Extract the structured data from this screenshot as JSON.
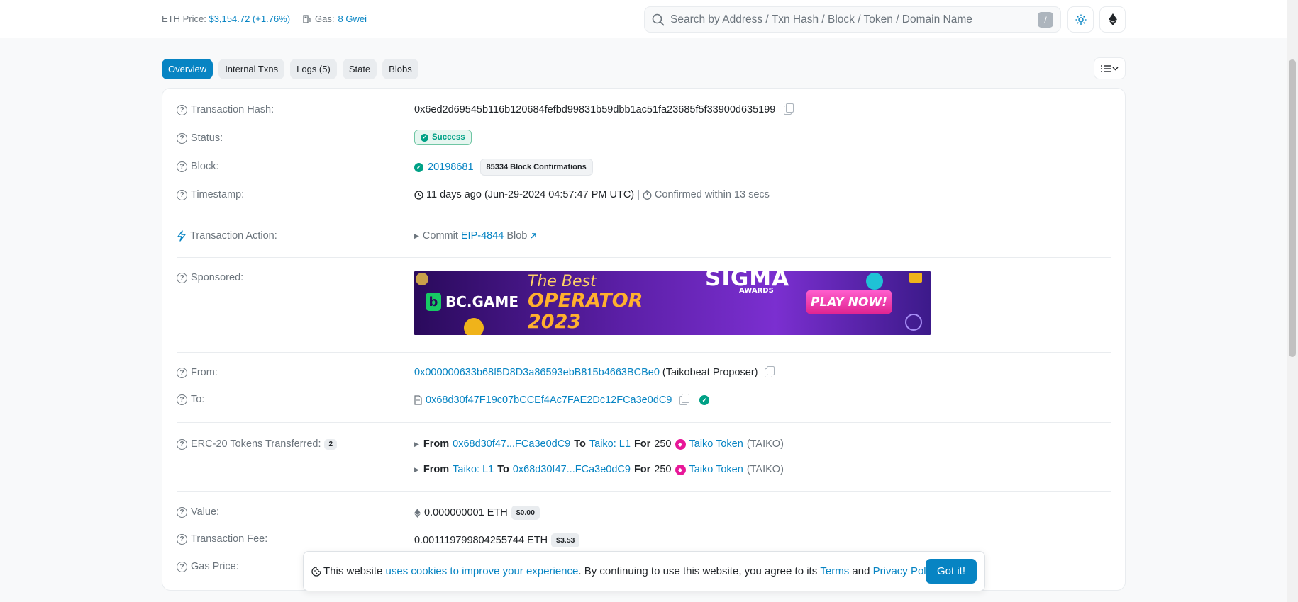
{
  "header": {
    "eth_price_label": "ETH Price:",
    "eth_price_value": "$3,154.72 (+1.76%)",
    "gas_label": "Gas:",
    "gas_value": "8 Gwei",
    "search_placeholder": "Search by Address / Txn Hash / Block / Token / Domain Name",
    "search_shortcut": "/"
  },
  "tabs": [
    "Overview",
    "Internal Txns",
    "Logs (5)",
    "State",
    "Blobs"
  ],
  "rows": {
    "tx_hash": {
      "label": "Transaction Hash:",
      "value": "0x6ed2d69545b116b120684fefbd99831b59dbb1ac51fa23685f5f33900d635199"
    },
    "status": {
      "label": "Status:",
      "value": "Success"
    },
    "block": {
      "label": "Block:",
      "value": "20198681",
      "confirmations": "85334 Block Confirmations"
    },
    "timestamp": {
      "label": "Timestamp:",
      "value": "11 days ago (Jun-29-2024 04:57:47 PM UTC)",
      "sep": "|",
      "confirmed": "Confirmed within 13 secs"
    },
    "action": {
      "label": "Transaction Action:",
      "commit": "Commit",
      "eip": "EIP-4844",
      "blob": "Blob"
    },
    "sponsored": {
      "label": "Sponsored:",
      "ad_brand": "BC.GAME",
      "ad_line1": "The Best",
      "ad_line2": "OPERATOR",
      "ad_line3": "2023",
      "ad_award": "SIGMA",
      "ad_award_sub": "AWARDS",
      "ad_cta": "PLAY NOW!"
    },
    "from": {
      "label": "From:",
      "address": "0x000000633b68f5D8D3a86593ebB815b4663BCBe0",
      "name": "(Taikobeat Proposer)"
    },
    "to": {
      "label": "To:",
      "address": "0x68d30f47F19c07bCCEf4Ac7FAE2Dc12FCa3e0dC9"
    },
    "erc20": {
      "label": "ERC-20 Tokens Transferred:",
      "count": "2",
      "transfers": [
        {
          "from_kw": "From",
          "from": "0x68d30f47...FCa3e0dC9",
          "to_kw": "To",
          "to": "Taiko: L1",
          "for_kw": "For",
          "amount": "250",
          "token": "Taiko Token",
          "symbol": "(TAIKO)"
        },
        {
          "from_kw": "From",
          "from": "Taiko: L1",
          "to_kw": "To",
          "to": "0x68d30f47...FCa3e0dC9",
          "for_kw": "For",
          "amount": "250",
          "token": "Taiko Token",
          "symbol": "(TAIKO)"
        }
      ]
    },
    "value": {
      "label": "Value:",
      "value": "0.000000001 ETH",
      "usd": "$0.00"
    },
    "fee": {
      "label": "Transaction Fee:",
      "value": "0.001119799804255744 ETH",
      "usd": "$3.53"
    },
    "gas_price": {
      "label": "Gas Price:"
    }
  },
  "cookie": {
    "text1": "This website",
    "link1": "uses cookies to improve your experience",
    "text2": ". By continuing to use this website, you agree to its",
    "terms": "Terms",
    "and": "and",
    "privacy": "Privacy Policy",
    "dot": ".",
    "button": "Got it!"
  }
}
